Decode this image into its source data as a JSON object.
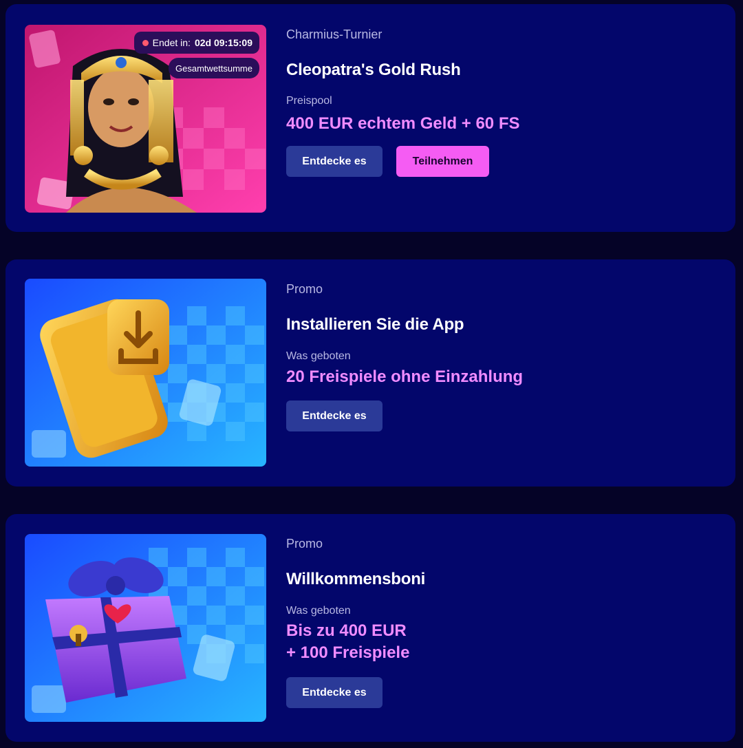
{
  "cards": [
    {
      "category": "Charmius-Turnier",
      "title": "Cleopatra's Gold Rush",
      "sublabel": "Preispool",
      "value": "400 EUR echtem Geld + 60 FS",
      "timer_label": "Endet in:",
      "timer_value": "02d 09:15:09",
      "badge_total": "Gesamtwettsumme",
      "explore_label": "Entdecke es",
      "join_label": "Teilnehmen",
      "image_icon": "cleopatra-icon"
    },
    {
      "category": "Promo",
      "title": "Installieren Sie die App",
      "sublabel": "Was geboten",
      "value": "20 Freispiele ohne Einzahlung",
      "explore_label": "Entdecke es",
      "image_icon": "phone-download-icon"
    },
    {
      "category": "Promo",
      "title": "Willkommensboni",
      "sublabel": "Was geboten",
      "value_line1": "Bis zu 400 EUR",
      "value_line2": "+ 100 Freispiele",
      "explore_label": "Entdecke es",
      "image_icon": "gift-box-icon"
    }
  ],
  "colors": {
    "page_bg": "#050327",
    "card_bg": "#03066b",
    "accent_pink": "#f08cff",
    "join_button": "#f55cf3",
    "explore_button": "#2b3a98"
  }
}
